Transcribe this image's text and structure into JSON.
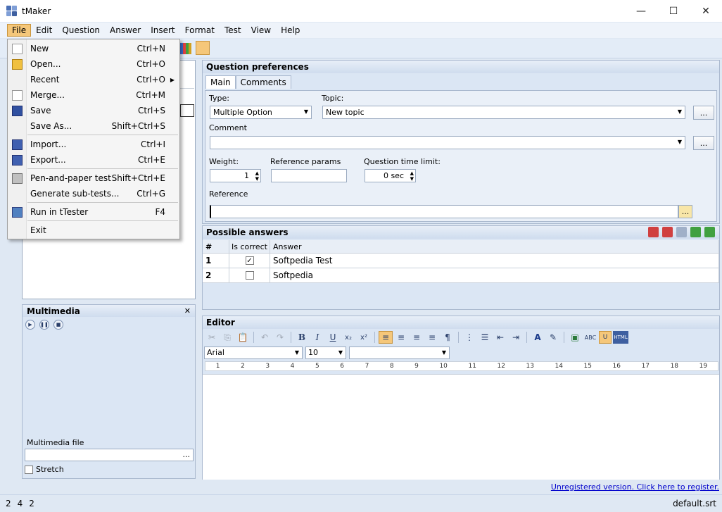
{
  "window": {
    "title": "tMaker",
    "minimize": "—",
    "maximize": "☐",
    "close": "✕"
  },
  "menu": [
    "File",
    "Edit",
    "Question",
    "Answer",
    "Insert",
    "Format",
    "Test",
    "View",
    "Help"
  ],
  "file_menu": {
    "items": [
      {
        "label": "New",
        "shortcut": "Ctrl+N",
        "icon": "new-file-icon"
      },
      {
        "label": "Open...",
        "shortcut": "Ctrl+O",
        "icon": "open-folder-icon"
      },
      {
        "label": "Recent",
        "shortcut": "Ctrl+O",
        "icon": "",
        "submenu": "▶"
      },
      {
        "label": "Merge...",
        "shortcut": "Ctrl+M",
        "icon": "merge-icon"
      },
      {
        "label": "Save",
        "shortcut": "Ctrl+S",
        "icon": "save-disk-icon"
      },
      {
        "label": "Save As...",
        "shortcut": "Shift+Ctrl+S",
        "icon": ""
      },
      {
        "label": "Import...",
        "shortcut": "Ctrl+I",
        "icon": "import-icon"
      },
      {
        "label": "Export...",
        "shortcut": "Ctrl+E",
        "icon": "export-icon"
      },
      {
        "label": "Pen-and-paper test",
        "shortcut": "Shift+Ctrl+E",
        "icon": "printer-icon"
      },
      {
        "label": "Generate sub-tests...",
        "shortcut": "Ctrl+G",
        "icon": ""
      },
      {
        "label": "Run in tTester",
        "shortcut": "F4",
        "icon": "ttester-icon"
      },
      {
        "label": "Exit",
        "shortcut": "",
        "icon": ""
      }
    ]
  },
  "multimedia": {
    "title": "Multimedia",
    "close": "✕",
    "play": "▶",
    "pause": "❚❚",
    "stop": "■",
    "file_label": "Multimedia file",
    "file_button": "...",
    "stretch_label": "Stretch"
  },
  "question_preferences": {
    "title": "Question preferences",
    "tabs": [
      "Main",
      "Comments"
    ],
    "type_label": "Type:",
    "type_value": "Multiple Option",
    "topic_label": "Topic:",
    "topic_value": "New topic",
    "comment_label": "Comment",
    "comment_value": "",
    "weight_label": "Weight:",
    "weight_value": "1",
    "ref_params_label": "Reference params",
    "ref_params_value": "",
    "time_limit_label": "Question time limit:",
    "time_limit_value": "0 sec",
    "reference_label": "Reference",
    "reference_value": "",
    "dots": "...",
    "spin_up": "▲",
    "spin_down": "▼",
    "dropdown_arrow": "▼"
  },
  "possible_answers": {
    "title": "Possible answers",
    "columns": [
      "#",
      "Is correct",
      "Answer"
    ],
    "rows": [
      {
        "num": "1",
        "correct": "✓",
        "answer": "Softpedia Test"
      },
      {
        "num": "2",
        "correct": "",
        "answer": "Softpedia"
      }
    ]
  },
  "editor": {
    "title": "Editor",
    "font_name": "Arial",
    "font_size": "10",
    "style_value": "",
    "ruler": [
      "1",
      "2",
      "3",
      "4",
      "5",
      "6",
      "7",
      "8",
      "9",
      "10",
      "11",
      "12",
      "13",
      "14",
      "15",
      "16",
      "17",
      "18",
      "19"
    ],
    "toolbar": {
      "cut": "✂",
      "copy": "⎘",
      "paste": "📋",
      "undo": "↶",
      "redo": "↷",
      "bold": "B",
      "italic": "I",
      "underline": "U",
      "subscript": "x₂",
      "superscript": "x²",
      "align_left": "≡",
      "align_center": "≡",
      "align_right": "≡",
      "justify": "≡",
      "paragraph": "¶",
      "list_number": "⋮",
      "list_bullet": "☰",
      "indent_dec": "⇤",
      "indent_inc": "⇥",
      "font_color": "A",
      "highlight": "✎",
      "image": "▣",
      "spell": "ABC",
      "html": "HTML"
    }
  },
  "status": {
    "registration": "Unregistered version. Click here to register.",
    "left_values": [
      "2",
      "4",
      "2"
    ],
    "right_value": "default.srt"
  },
  "colors": {
    "accent": "#f5c77a",
    "panel_bg": "#dbe6f4",
    "link": "#0000cc"
  }
}
